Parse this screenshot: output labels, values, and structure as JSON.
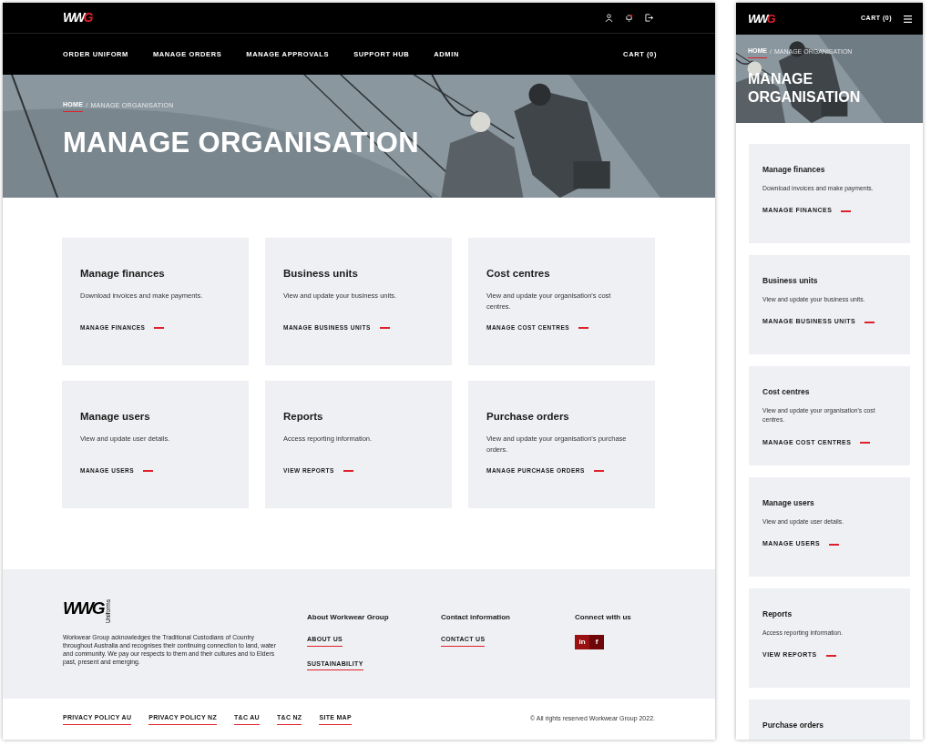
{
  "desktop": {
    "logo": {
      "text": "WW",
      "accent": "G"
    },
    "nav": [
      {
        "label": "ORDER UNIFORM"
      },
      {
        "label": "MANAGE ORDERS"
      },
      {
        "label": "MANAGE APPROVALS"
      },
      {
        "label": "SUPPORT HUB"
      },
      {
        "label": "ADMIN"
      }
    ],
    "cart": "CART (0)",
    "breadcrumb": [
      {
        "label": "HOME",
        "kind": "link"
      },
      {
        "label": "/",
        "kind": "separator"
      },
      {
        "label": "MANAGE ORGANISATION",
        "kind": "current"
      }
    ],
    "title": "MANAGE ORGANISATION",
    "cards": [
      {
        "title": "Manage finances",
        "description": "Download invoices and make payments.",
        "link": "MANAGE FINANCES"
      },
      {
        "title": "Business units",
        "description": "View and update your business units.",
        "link": "MANAGE BUSINESS UNITS"
      },
      {
        "title": "Cost centres",
        "description": "View and update your organisation's cost centres.",
        "link": "MANAGE COST CENTRES"
      },
      {
        "title": "Manage users",
        "description": "View and update user details.",
        "link": "MANAGE USERS"
      },
      {
        "title": "Reports",
        "description": "Access reporting information.",
        "link": "VIEW REPORTS"
      },
      {
        "title": "Purchase orders",
        "description": "View and update your organisation's purchase orders.",
        "link": "MANAGE PURCHASE ORDERS"
      }
    ],
    "footer": {
      "logo": "WWG",
      "logo_tag": "Uniforms",
      "acknowledgement": "Workwear Group acknowledges the Traditional Custodians of Country throughout Australia and recognises their continuing connection to land, water and community. We pay our respects to them and their cultures and to Elders past, present and emerging.",
      "columns": [
        {
          "heading": "About Workwear Group",
          "links": [
            "ABOUT US",
            "SUSTAINABILITY"
          ]
        },
        {
          "heading": "Contact information",
          "links": [
            "CONTACT US"
          ]
        },
        {
          "heading": "Connect with us",
          "social": [
            {
              "label": "in",
              "color": "#9b1010"
            },
            {
              "label": "f",
              "color": "#6e0808"
            }
          ]
        }
      ],
      "legal_links": [
        "PRIVACY POLICY AU",
        "PRIVACY POLICY NZ",
        "T&C AU",
        "T&C NZ",
        "SITE MAP"
      ],
      "copyright": "© All rights reserved Workwear Group 2022."
    }
  },
  "mobile": {
    "logo": {
      "text": "WW",
      "accent": "G"
    },
    "cart": "CART (0)",
    "breadcrumb": [
      {
        "label": "HOME",
        "kind": "link"
      },
      {
        "label": "/",
        "kind": "separator"
      },
      {
        "label": "MANAGE ORGANISATION",
        "kind": "current"
      }
    ],
    "title": "MANAGE ORGANISATION",
    "cards": [
      {
        "title": "Manage finances",
        "description": "Download invoices and make payments.",
        "link": "MANAGE FINANCES"
      },
      {
        "title": "Business units",
        "description": "View and update your business units.",
        "link": "MANAGE BUSINESS UNITS"
      },
      {
        "title": "Cost centres",
        "description": "View and update your organisation's cost centres.",
        "link": "MANAGE COST CENTRES"
      },
      {
        "title": "Manage users",
        "description": "View and update user details.",
        "link": "MANAGE USERS"
      },
      {
        "title": "Reports",
        "description": "Access reporting information.",
        "link": "VIEW REPORTS"
      },
      {
        "title": "Purchase orders"
      }
    ]
  }
}
